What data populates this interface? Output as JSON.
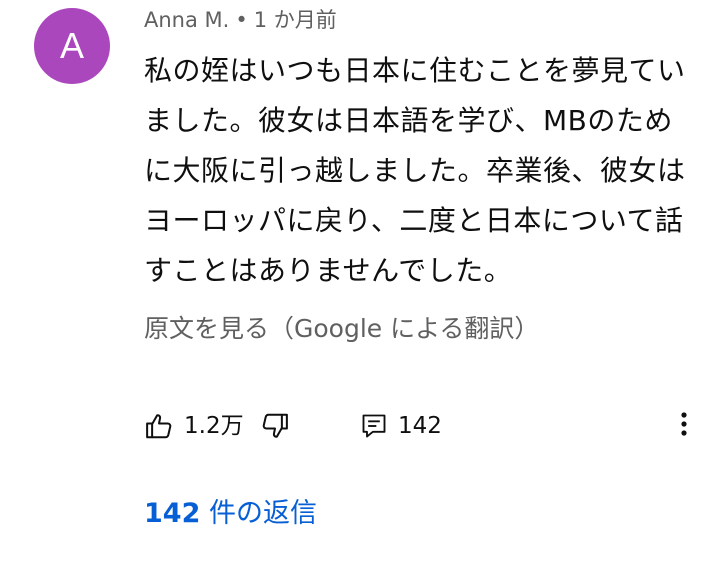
{
  "comment": {
    "avatar_letter": "A",
    "avatar_color": "#ab47bc",
    "author": "Anna M.",
    "separator": "•",
    "timestamp": "1 か月前",
    "text_lines": [
      "私の姪はいつも日本に住むことを夢見てい",
      "ました。彼女は日本語を学び、MBのため",
      "に大阪に引っ越しました。卒業後、彼女は",
      "ヨーロッパに戻り、二度と日本について話",
      "すことはありませんでした。"
    ],
    "translate_label": "原文を見る（Google による翻訳）"
  },
  "actions": {
    "like_icon": "thumb-up-icon",
    "like_count": "1.2万",
    "dislike_icon": "thumb-down-icon",
    "reply_icon": "comment-reply-icon",
    "reply_count": "142",
    "more_icon": "more-vert-icon"
  },
  "replies": {
    "count": "142",
    "label": " 件の返信",
    "color": "#065fd4"
  }
}
